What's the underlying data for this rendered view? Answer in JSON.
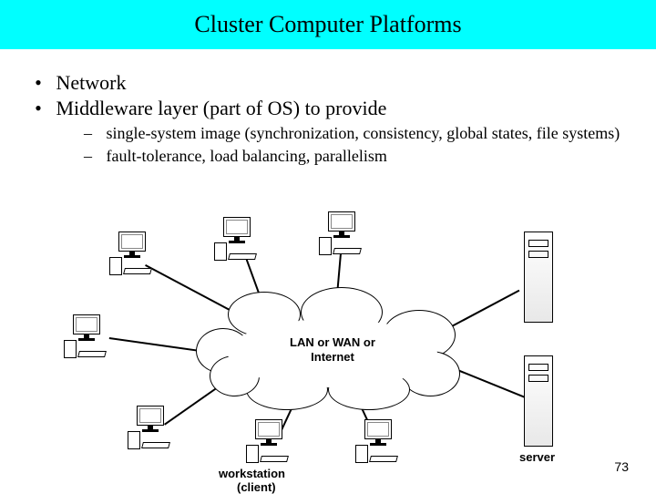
{
  "title": "Cluster Computer Platforms",
  "bullets": {
    "b1": "Network",
    "b2": "Middleware layer (part of OS) to provide",
    "sub1": "single-system image (synchronization, consistency, global states, file systems)",
    "sub2": "fault-tolerance, load balancing, parallelism"
  },
  "diagram": {
    "cloud_line1": "LAN or WAN or",
    "cloud_line2": "Internet",
    "workstation_label": "workstation",
    "client_label": "(client)",
    "server_label": "server"
  },
  "page_number": "73"
}
